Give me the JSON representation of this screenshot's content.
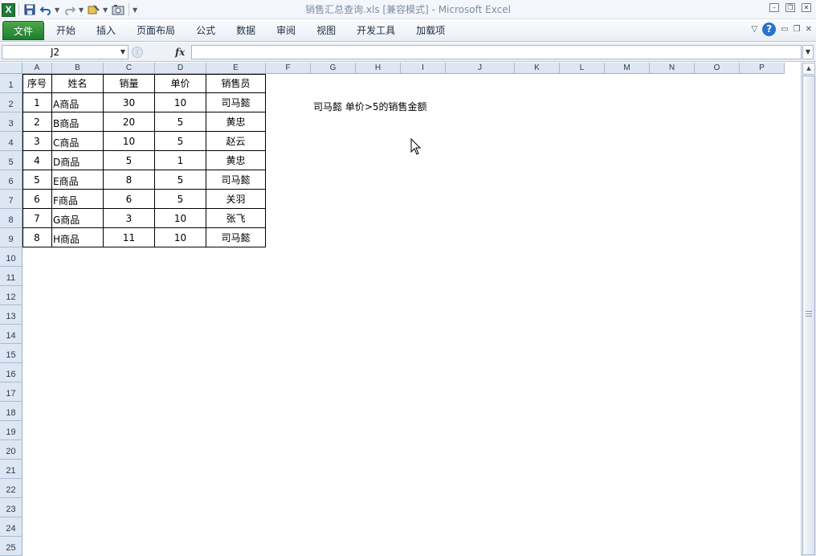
{
  "window": {
    "title": "销售汇总查询.xls  [兼容模式]  -  Microsoft Excel",
    "app_icon_letter": "X"
  },
  "ribbon": {
    "tabs": [
      {
        "label": "文件"
      },
      {
        "label": "开始"
      },
      {
        "label": "插入"
      },
      {
        "label": "页面布局"
      },
      {
        "label": "公式"
      },
      {
        "label": "数据"
      },
      {
        "label": "审阅"
      },
      {
        "label": "视图"
      },
      {
        "label": "开发工具"
      },
      {
        "label": "加载项"
      }
    ],
    "help_label": "?"
  },
  "formula_bar": {
    "name_box": "J2",
    "fx_label": "fx",
    "formula": ""
  },
  "sheet": {
    "columns": [
      "A",
      "B",
      "C",
      "D",
      "E",
      "F",
      "G",
      "H",
      "I",
      "J",
      "K",
      "L",
      "M",
      "N",
      "O",
      "P"
    ],
    "rows": [
      "1",
      "2",
      "3",
      "4",
      "5",
      "6",
      "7",
      "8",
      "9",
      "10",
      "11",
      "12",
      "13",
      "14",
      "15",
      "16",
      "17",
      "18",
      "19",
      "20",
      "21",
      "22",
      "23",
      "24",
      "25"
    ],
    "table": {
      "headers": [
        "序号",
        "姓名",
        "销量",
        "单价",
        "销售员"
      ],
      "rows": [
        [
          "1",
          "A商品",
          "30",
          "10",
          "司马懿"
        ],
        [
          "2",
          "B商品",
          "20",
          "5",
          "黄忠"
        ],
        [
          "3",
          "C商品",
          "10",
          "5",
          "赵云"
        ],
        [
          "4",
          "D商品",
          "5",
          "1",
          "黄忠"
        ],
        [
          "5",
          "E商品",
          "8",
          "5",
          "司马懿"
        ],
        [
          "6",
          "F商品",
          "6",
          "5",
          "关羽"
        ],
        [
          "7",
          "G商品",
          "3",
          "10",
          "张飞"
        ],
        [
          "8",
          "H商品",
          "11",
          "10",
          "司马懿"
        ]
      ]
    },
    "note": "司马懿 单价>5的销售金额"
  },
  "colors": {
    "file_tab": "#1d7d2e",
    "header_bg": "#dde6f2",
    "title_text": "#7c8ea5"
  }
}
